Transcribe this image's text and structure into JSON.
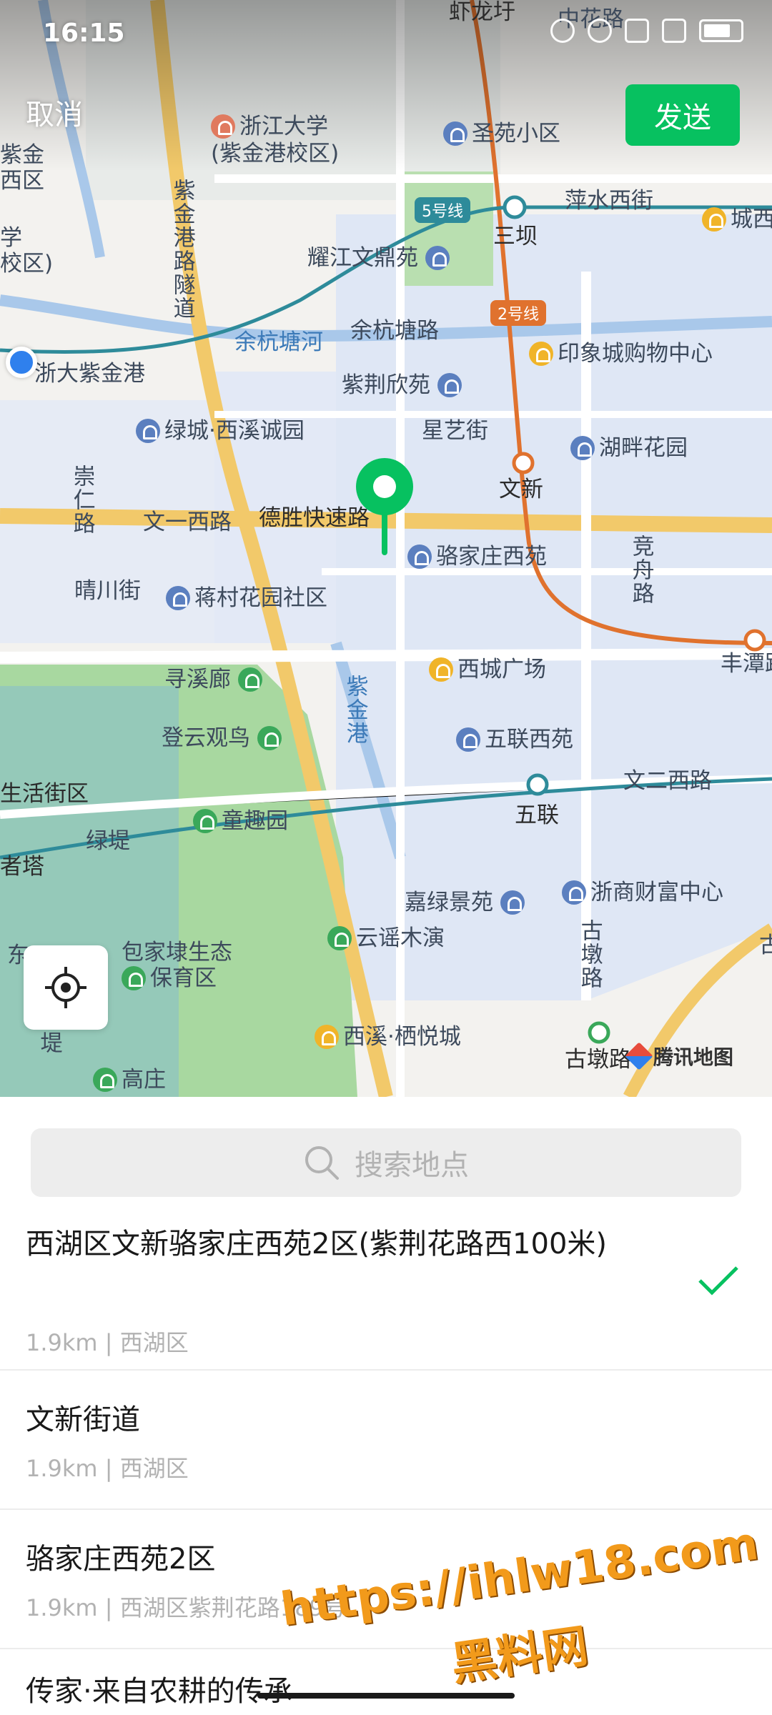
{
  "status_bar": {
    "time": "16:15"
  },
  "header": {
    "cancel_label": "取消",
    "send_label": "发送"
  },
  "map": {
    "labels": {
      "l1": "虾龙圩",
      "l2": "中花路",
      "l3": "浙江大学",
      "l4": "(紫金港校区)",
      "l5": "圣苑小区",
      "l6": "紫金",
      "l7": "西区",
      "l8": "学",
      "l9": "校区)",
      "l10": "5号线",
      "l11": "三坝",
      "l12": "萍水西街",
      "l13": "城西",
      "l14": "紫金港路隧道",
      "l15": "耀江文鼎苑",
      "l16": "2号线",
      "l17": "余杭塘河",
      "l18": "余杭塘路",
      "l19": "印象城购物中心",
      "l20": "浙大紫金港",
      "l21": "紫荆欣苑",
      "l22": "绿城·西溪诚园",
      "l23": "星艺街",
      "l24": "湖畔花园",
      "l25": "崇仁路",
      "l26": "文新",
      "l27": "文一西路",
      "l28": "德胜快速路",
      "l29": "骆家庄西苑",
      "l30": "竞舟路",
      "l31": "晴川街",
      "l32": "蒋村花园社区",
      "l33": "丰潭路",
      "l34": "寻溪廊",
      "l35": "西城广场",
      "l36": "紫金港",
      "l37": "登云观鸟",
      "l38": "五联西苑",
      "l39": "生活街区",
      "l40": "童趣园",
      "l41": "五联",
      "l42": "文二西路",
      "l43": "绿堤",
      "l44": "者塔",
      "l45": "嘉绿景苑",
      "l46": "浙商财富中心",
      "l47": "古墩路",
      "l48": "包家埭生态",
      "l49": "保育区",
      "l50": "云谣木演",
      "l51": "西溪·栖悦城",
      "l52": "古墩路",
      "l53": "高庄",
      "l54": "福堤",
      "l55": "古",
      "l56": "东"
    },
    "brand": "腾讯地图"
  },
  "search": {
    "placeholder": "搜索地点"
  },
  "results": [
    {
      "title": "西湖区文新骆家庄西苑2区(紫荆花路西100米)",
      "subtitle": "1.9km | 西湖区",
      "selected": true
    },
    {
      "title": "文新街道",
      "subtitle": "1.9km | 西湖区",
      "selected": false
    },
    {
      "title": "骆家庄西苑2区",
      "subtitle": "1.9km | 西湖区紫荆花路189号",
      "selected": false
    },
    {
      "title": "传家·来自农耕的传承",
      "subtitle": "",
      "selected": false
    }
  ],
  "watermark": {
    "line1": "https://ihlw18.com",
    "line2": "黑料网"
  },
  "colors": {
    "accent": "#07c160",
    "metro_line2": "#e0722e",
    "metro_line5": "#2e8b9a"
  }
}
